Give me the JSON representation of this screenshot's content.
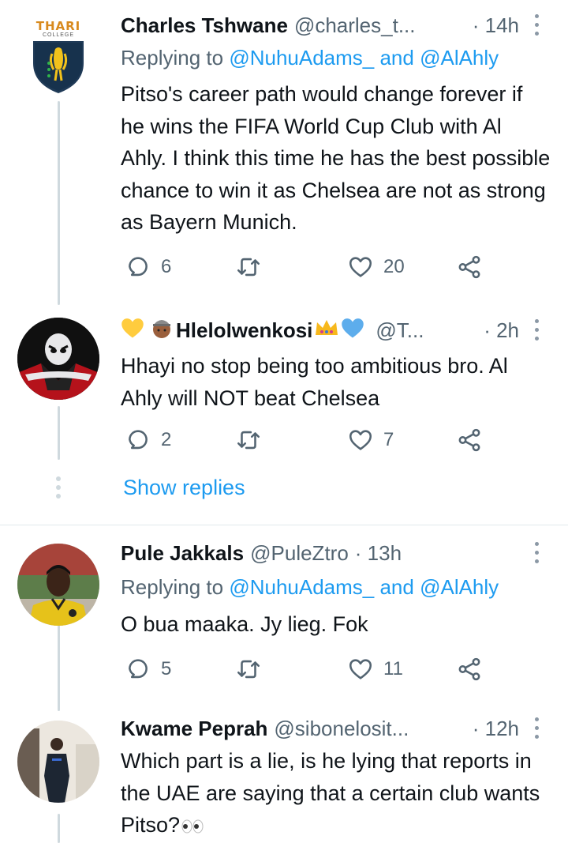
{
  "tweets": [
    {
      "name": "Charles Tshwane",
      "handle": "@charles_t...",
      "time": "· 14h",
      "replying_prefix": "Replying to ",
      "replying_user1": "@NuhuAdams_",
      "replying_and": " and ",
      "replying_user2": "@AlAhly",
      "text": "Pitso's career path would change forever if he wins the FIFA World Cup Club with Al Ahly. I think this time he has the best possible chance to win it as Chelsea are not as strong as Bayern Munich.",
      "replies": "6",
      "likes": "20",
      "avatar_text": "THARI",
      "avatar_subtext": "COLLEGE",
      "avatar_icon": "school-crest"
    },
    {
      "name": "Hlelolwenkosi",
      "handle": "@T...",
      "time": "· 2h",
      "text": "Hhayi no stop being too ambitious bro. Al Ahly will NOT beat Chelsea",
      "replies": "2",
      "likes": "7",
      "avatar_icon": "anime-character",
      "name_emojis": [
        "yellow-heart",
        "person-emoji",
        "crown-emoji",
        "blue-heart"
      ]
    },
    {
      "name": "Pule Jakkals",
      "handle": "@PuleZtro",
      "time": "· 13h",
      "replying_prefix": "Replying to ",
      "replying_user1": "@NuhuAdams_",
      "replying_and": " and ",
      "replying_user2": "@AlAhly",
      "text": "O bua maaka. Jy lieg. Fok",
      "replies": "5",
      "likes": "11",
      "avatar_icon": "footballer-photo"
    },
    {
      "name": "Kwame Peprah",
      "handle": "@sibonelosit...",
      "time": "· 12h",
      "text": "Which part is a lie, is he  lying that reports in the UAE are saying that a certain club wants Pitso?",
      "avatar_icon": "person-photo",
      "text_emoji": "eyes-emoji"
    }
  ],
  "show_replies": "Show replies",
  "colors": {
    "link": "#1d9bf0",
    "secondary": "#536471",
    "thread": "#cfd9de"
  },
  "icons": [
    "reply-icon",
    "retweet-icon",
    "like-icon",
    "share-icon",
    "more-icon"
  ]
}
